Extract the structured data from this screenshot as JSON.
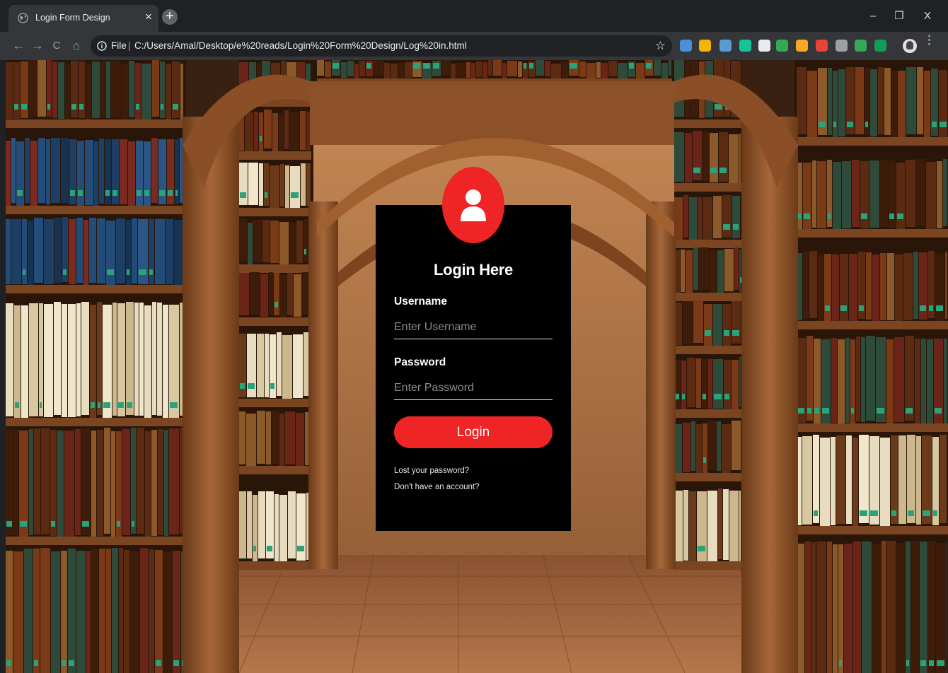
{
  "browser": {
    "tab_title": "Login Form Design",
    "tab_close": "×",
    "new_tab": "+",
    "window_controls": {
      "minimize": "–",
      "restore": "❐",
      "close": "X"
    },
    "nav": {
      "back": "←",
      "forward": "→",
      "reload": "C",
      "home": "⌂"
    },
    "address": {
      "scheme": "File",
      "separator": "|",
      "url": "C:/Users/Amal/Desktop/e%20reads/Login%20Form%20Design/Log%20in.html"
    },
    "bookmark_icon": "star-icon",
    "extensions": [
      {
        "name": "ext-blue-person-icon",
        "color": "#4a90d9"
      },
      {
        "name": "ext-multicolor-icon",
        "color": "#f4b400"
      },
      {
        "name": "ext-translate-icon",
        "color": "#5b9bd5"
      },
      {
        "name": "ext-grammarly-icon",
        "color": "#15c39a"
      },
      {
        "name": "ext-circle-icon",
        "color": "#e8eaed"
      },
      {
        "name": "ext-green-ring-icon",
        "color": "#34a853"
      },
      {
        "name": "ext-colorful-wheel-icon",
        "color": "#f9a825"
      },
      {
        "name": "ext-red-square-icon",
        "color": "#ea4335"
      },
      {
        "name": "ext-grey-bulb-icon",
        "color": "#9aa0a6"
      },
      {
        "name": "ext-green-gem-icon",
        "color": "#34a853"
      },
      {
        "name": "ext-green-drop-icon",
        "color": "#0f9d58"
      }
    ],
    "menu": "⋮"
  },
  "login": {
    "title": "Login Here",
    "username_label": "Username",
    "username_placeholder": "Enter Username",
    "username_value": "",
    "password_label": "Password",
    "password_placeholder": "Enter Password",
    "password_value": "",
    "button_label": "Login",
    "lost_password_link": "Lost your password?",
    "signup_link": "Don't have an account?",
    "accent_color": "#ee2425",
    "card_color": "#000000"
  }
}
